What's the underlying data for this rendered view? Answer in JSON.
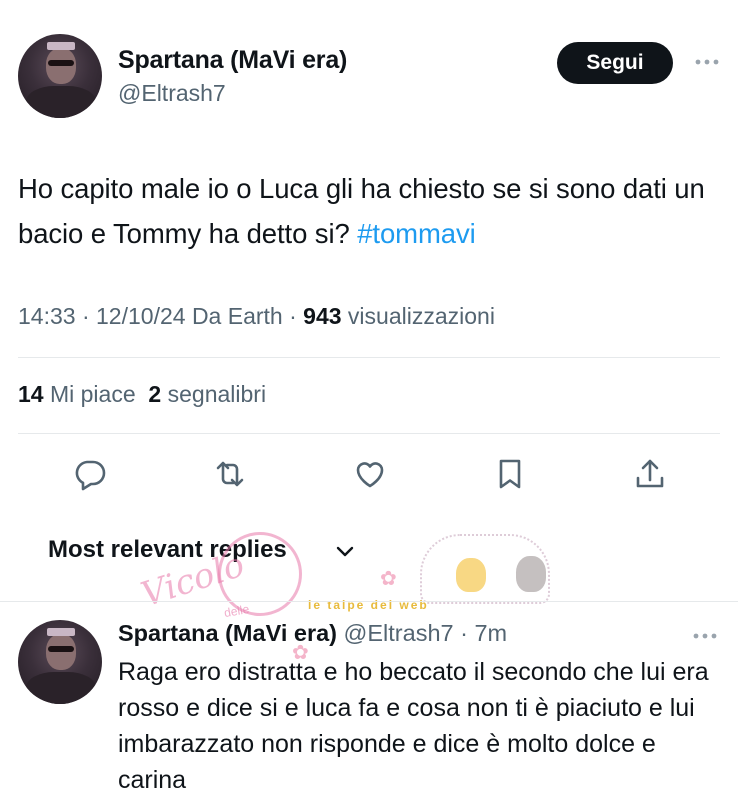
{
  "tweet": {
    "author_name": "Spartana (MaVi era)",
    "author_handle": "@Eltrash7",
    "follow_label": "Segui",
    "text": "Ho capito male io o Luca gli ha chiesto se si sono dati un bacio e Tommy ha detto si? ",
    "hashtag": "#tommavi",
    "time": "14:33",
    "date": "12/10/24",
    "source": "Da Earth",
    "views_count": "943",
    "views_label": "visualizzazioni",
    "likes_count": "14",
    "likes_label": "Mi piace",
    "bookmarks_count": "2",
    "bookmarks_label": "segnalibri",
    "actions": [
      "reply-icon",
      "retweet-icon",
      "like-icon",
      "bookmark-icon",
      "share-icon"
    ]
  },
  "replies": {
    "header": "Most relevant replies",
    "items": [
      {
        "author_name": "Spartana (MaVi era)",
        "author_handle": "@Eltrash7",
        "time": "7m",
        "text": "Raga ero distratta e ho beccato il secondo che lui era rosso e dice si e luca fa e cosa non ti è piaciuto e lui imbarazzato non risponde e dice è molto dolce e carina"
      }
    ]
  },
  "watermark": {
    "script": "Vicolo",
    "small": "delle",
    "banner": "le talpe del web"
  },
  "colors": {
    "text": "#0f1419",
    "secondary": "#536471",
    "link": "#1d9bf0",
    "follow_bg": "#0f1419",
    "divider": "#e6e9eb"
  }
}
